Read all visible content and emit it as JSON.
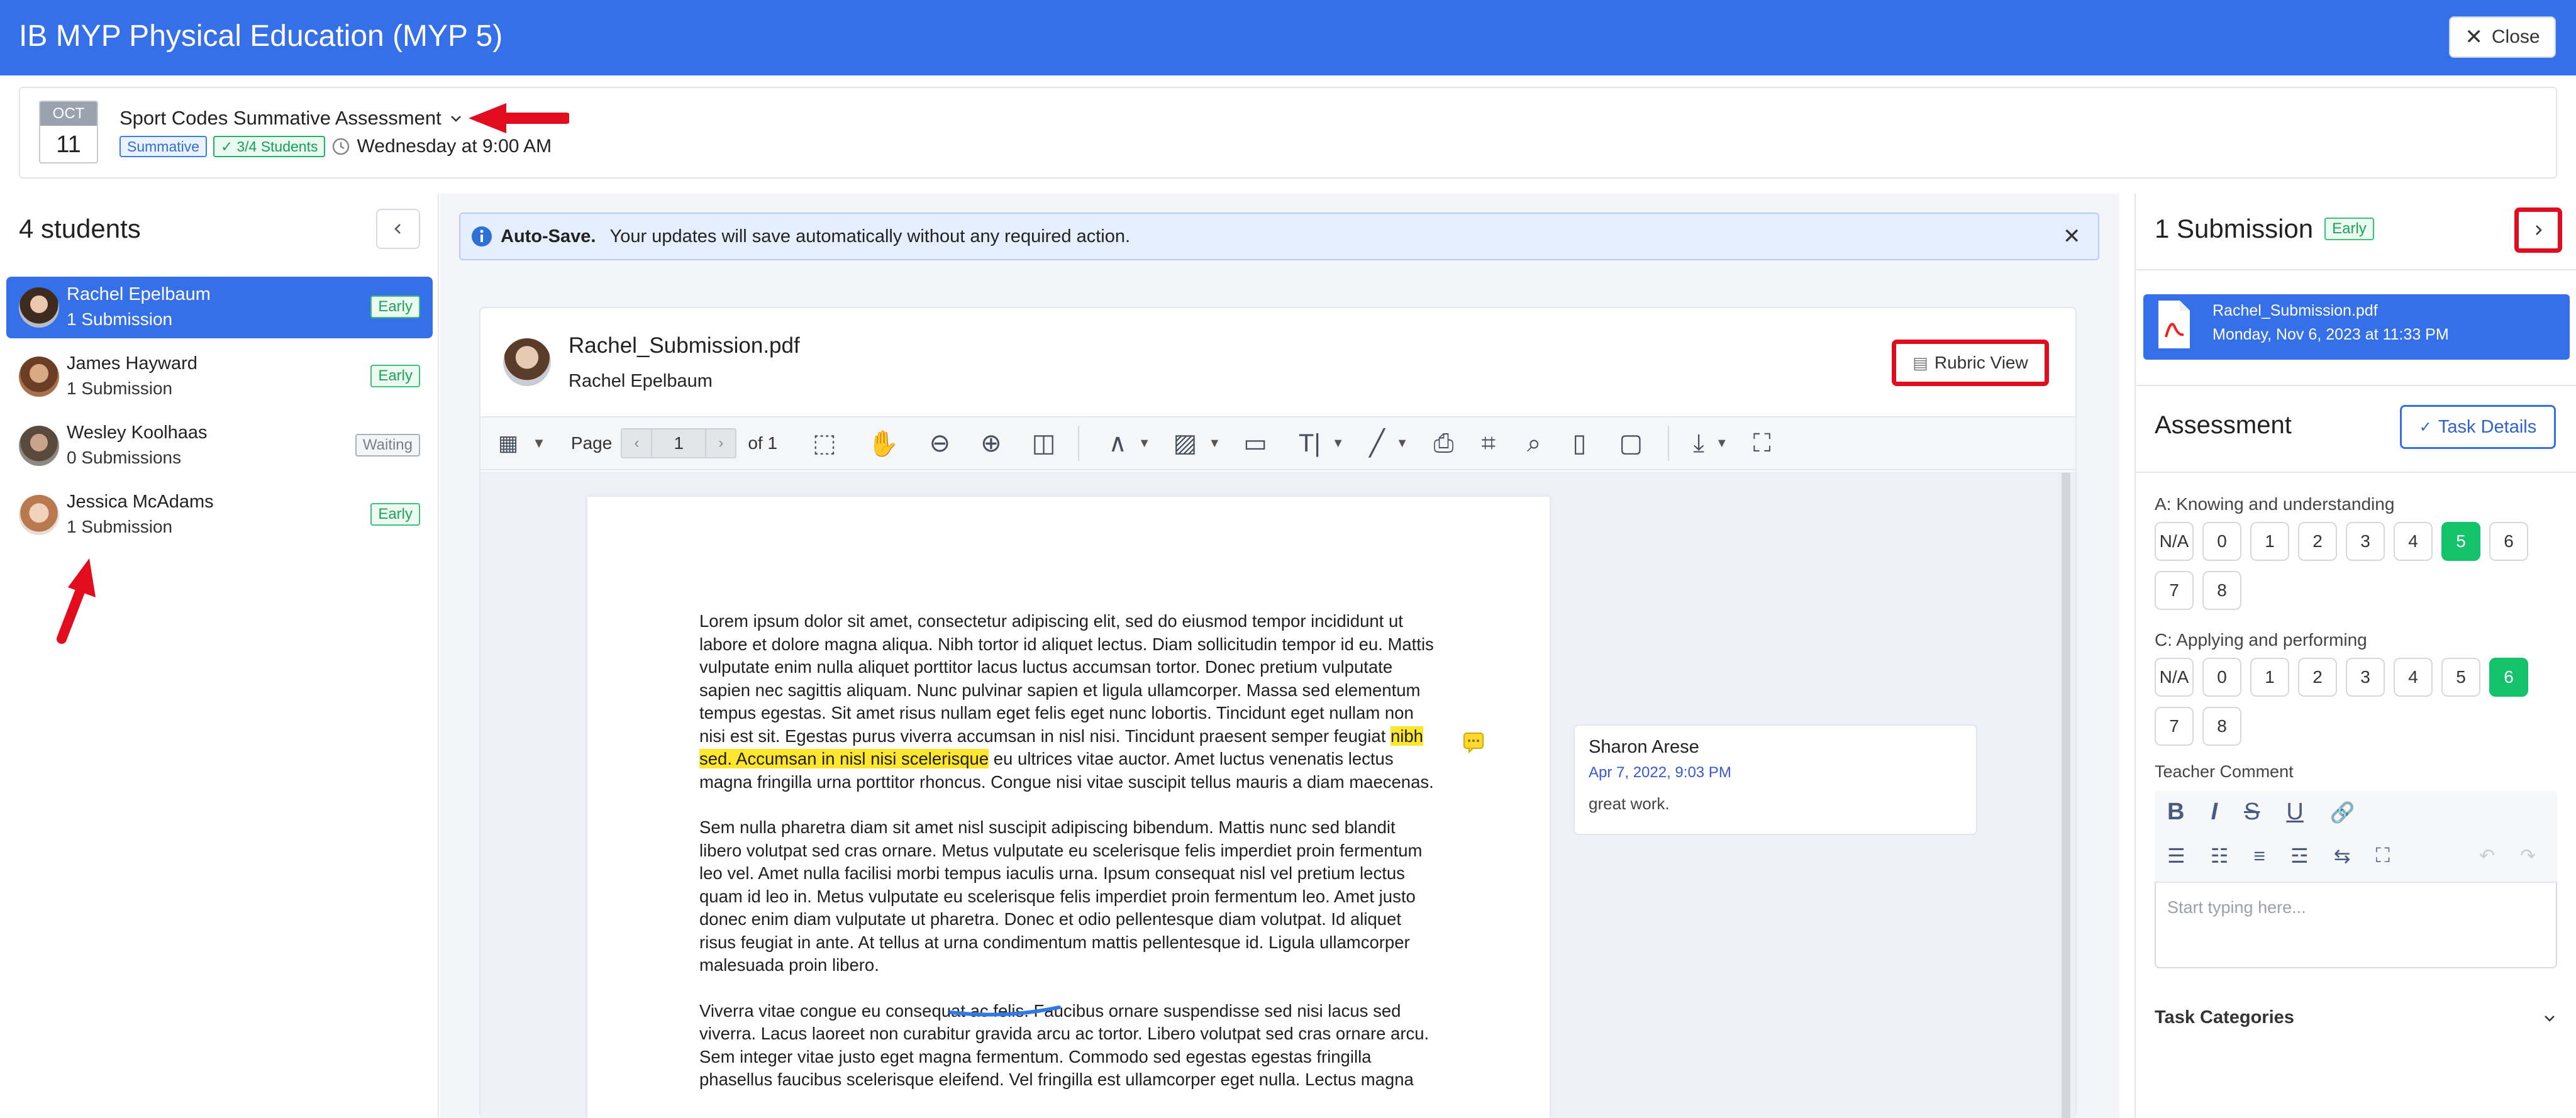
{
  "app": {
    "title": "IB MYP Physical Education (MYP 5)",
    "close_label": "Close"
  },
  "assignment": {
    "month": "OCT",
    "day": "11",
    "title": "Sport Codes Summative Assessment",
    "type_tag": "Summative",
    "students_tag": "3/4 Students",
    "due": "Wednesday at 9:00 AM"
  },
  "students_panel": {
    "heading": "4 students",
    "collapse_icon": "chevron-left-icon",
    "students": [
      {
        "name": "Rachel Epelbaum",
        "sub": "1 Submission",
        "status": "Early",
        "selected": true
      },
      {
        "name": "James Hayward",
        "sub": "1 Submission",
        "status": "Early",
        "selected": false
      },
      {
        "name": "Wesley Koolhaas",
        "sub": "0 Submissions",
        "status": "Waiting",
        "selected": false
      },
      {
        "name": "Jessica McAdams",
        "sub": "1 Submission",
        "status": "Early",
        "selected": false
      }
    ]
  },
  "autosave": {
    "title": "Auto-Save.",
    "message": "Your updates will save automatically without any required action."
  },
  "viewer": {
    "file_name": "Rachel_Submission.pdf",
    "student": "Rachel Epelbaum",
    "rubric_label": "Rubric View",
    "page_label": "Page",
    "page_value": "1",
    "page_total": "of 1",
    "paragraphs": [
      {
        "before": "Lorem ipsum dolor sit amet, consectetur adipiscing elit, sed do eiusmod tempor incididunt ut labore et dolore magna aliqua. Nibh tortor id aliquet lectus. Diam sollicitudin tempor id eu. Mattis vulputate enim nulla aliquet porttitor lacus luctus accumsan tortor. Donec pretium vulputate sapien nec sagittis aliquam. Nunc pulvinar sapien et ligula ullamcorper. Massa sed elementum tempus egestas. Sit amet risus nullam eget felis eget nunc lobortis. Tincidunt eget nullam non nisi est sit. Egestas purus viverra accumsan in nisl nisi. Tincidunt praesent semper feugiat ",
        "highlight": "nibh sed. Accumsan in nisl nisi scelerisque",
        "after": " eu ultrices vitae auctor. Amet luctus venenatis lectus magna fringilla urna porttitor rhoncus. Congue nisi vitae suscipit tellus mauris a diam maecenas."
      },
      {
        "text": "Sem nulla pharetra diam sit amet nisl suscipit adipiscing bibendum. Mattis nunc sed blandit libero volutpat sed cras ornare. Metus vulputate eu scelerisque felis imperdiet proin fermentum leo vel. Amet nulla facilisi morbi tempus iaculis urna. Ipsum consequat nisl vel pretium lectus quam id leo in. Metus vulputate eu scelerisque felis imperdiet proin fermentum leo. Amet justo donec enim diam vulputate ut pharetra. Donec et odio pellentesque diam volutpat. Id aliquet risus feugiat in ante. At tellus at urna condimentum mattis pellentesque id. Ligula ullamcorper malesuada proin libero."
      },
      {
        "text": "Viverra vitae congue eu consequat ac felis. Faucibus ornare suspendisse sed nisi lacus sed viverra. Lacus laoreet non curabitur gravida arcu ac tortor. Libero volutpat sed cras ornare arcu. Sem integer vitae justo eget magna fermentum. Commodo sed egestas egestas fringilla phasellus faucibus scelerisque eleifend. Vel fringilla est ullamcorper eget nulla. Lectus magna"
      }
    ],
    "comment": {
      "author": "Sharon Arese",
      "date": "Apr 7, 2022, 9:03 PM",
      "text": "great work."
    }
  },
  "submission_panel": {
    "heading": "1 Submission",
    "status": "Early",
    "file": {
      "name": "Rachel_Submission.pdf",
      "date": "Monday, Nov 6, 2023 at 11:33 PM"
    },
    "assessment_heading": "Assessment",
    "task_details_label": "Task Details",
    "criteria": [
      {
        "label": "A: Knowing and understanding",
        "options": [
          "N/A",
          "0",
          "1",
          "2",
          "3",
          "4",
          "5",
          "6",
          "7",
          "8"
        ],
        "selected": "5"
      },
      {
        "label": "C: Applying and performing",
        "options": [
          "N/A",
          "0",
          "1",
          "2",
          "3",
          "4",
          "5",
          "6",
          "7",
          "8"
        ],
        "selected": "6"
      }
    ],
    "comment_label": "Teacher Comment",
    "comment_placeholder": "Start typing here...",
    "categories_label": "Task Categories"
  },
  "colors": {
    "brand": "#3670e8",
    "success": "#14c26b",
    "annotation": "#e10c1d",
    "highlight": "#ffe62e"
  }
}
